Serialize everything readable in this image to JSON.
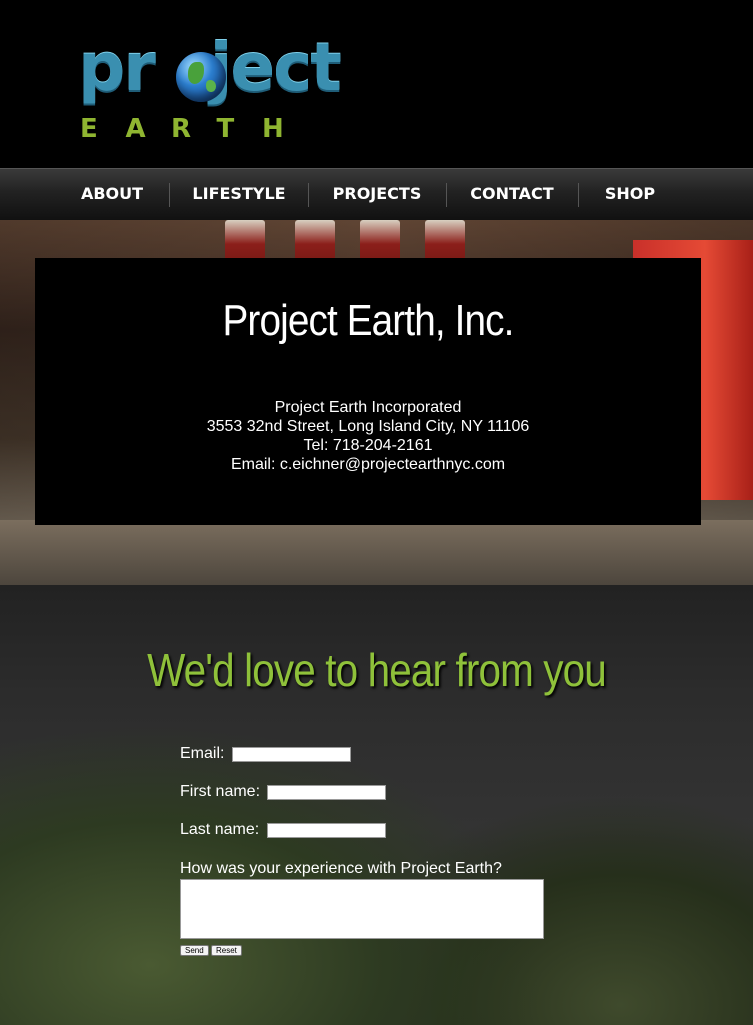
{
  "logo": {
    "word_left": "pr",
    "word_right": "ject",
    "sub_letters": [
      "E",
      "A",
      "R",
      "T",
      "H"
    ],
    "globe_icon": "globe-icon"
  },
  "nav": {
    "items": [
      {
        "label": "ABOUT"
      },
      {
        "label": "LIFESTYLE"
      },
      {
        "label": "PROJECTS"
      },
      {
        "label": "CONTACT"
      },
      {
        "label": "SHOP"
      }
    ]
  },
  "contact_info": {
    "title": "Project Earth, Inc.",
    "company": "Project Earth Incorporated",
    "address": "3553 32nd Street, Long Island City, NY 11106",
    "phone": "Tel: 718-204-2161",
    "email": "Email: c.eichner@projectearthnyc.com"
  },
  "feedback": {
    "heading": "We'd love to hear from you",
    "email_label": "Email:",
    "email_value": "",
    "first_name_label": "First name:",
    "first_name_value": "",
    "last_name_label": "Last name:",
    "last_name_value": "",
    "question_label": "How was your experience with Project Earth?",
    "comment_value": "",
    "send_label": "Send",
    "reset_label": "Reset"
  },
  "colors": {
    "brand_blue": "#3a8fb0",
    "brand_green": "#8fc13a",
    "background": "#000000"
  }
}
